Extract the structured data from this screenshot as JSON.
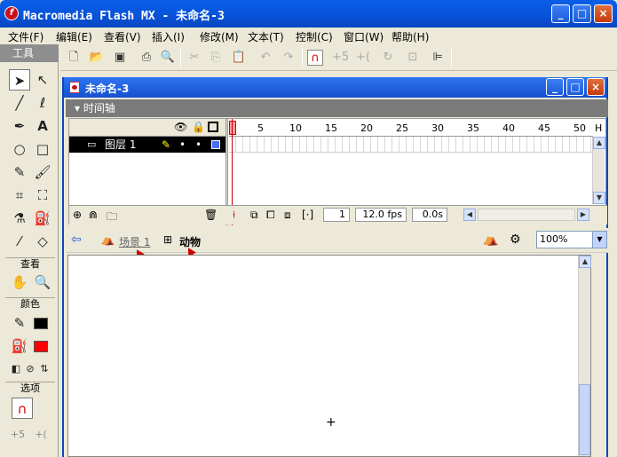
{
  "app": {
    "title": "Macromedia Flash MX - 未命名-3",
    "icon": "flash-icon",
    "window_buttons": [
      "_",
      "□",
      "×"
    ]
  },
  "menubar": [
    "文件(F)",
    "编辑(E)",
    "查看(V)",
    "插入(I)",
    "修改(M)",
    "文本(T)",
    "控制(C)",
    "窗口(W)",
    "帮助(H)"
  ],
  "toolbar": {
    "buttons": [
      "new-file-icon",
      "open-folder-icon",
      "save-icon",
      "print-icon",
      "print-preview-icon",
      "cut-icon",
      "copy-icon",
      "paste-icon",
      "undo-icon",
      "redo-icon",
      "snap-magnet-icon",
      "smooth-icon",
      "straighten-icon",
      "rotate-icon",
      "scale-icon",
      "align-icon"
    ]
  },
  "tools_panel": {
    "title": "工具",
    "view_label": "查看",
    "colors_label": "颜色",
    "options_label": "选项",
    "stroke_color": "#000000",
    "fill_color": "#ff0000"
  },
  "document": {
    "title": "未命名-3",
    "timeline_label": "时间轴",
    "frame_numbers": [
      "5",
      "10",
      "15",
      "20",
      "25",
      "30",
      "35",
      "40",
      "45",
      "50"
    ],
    "frame_unit": "H",
    "layer_name": "图层 1",
    "current_frame": "1",
    "fps": "12.0 fps",
    "elapsed": "0.0s",
    "scene_label": "场景 1",
    "symbol_label": "动物",
    "zoom": "100%",
    "stage_crosshair": "+"
  },
  "colors": {
    "titlebar": "#0a52d8",
    "highlight": "#cc0000"
  }
}
